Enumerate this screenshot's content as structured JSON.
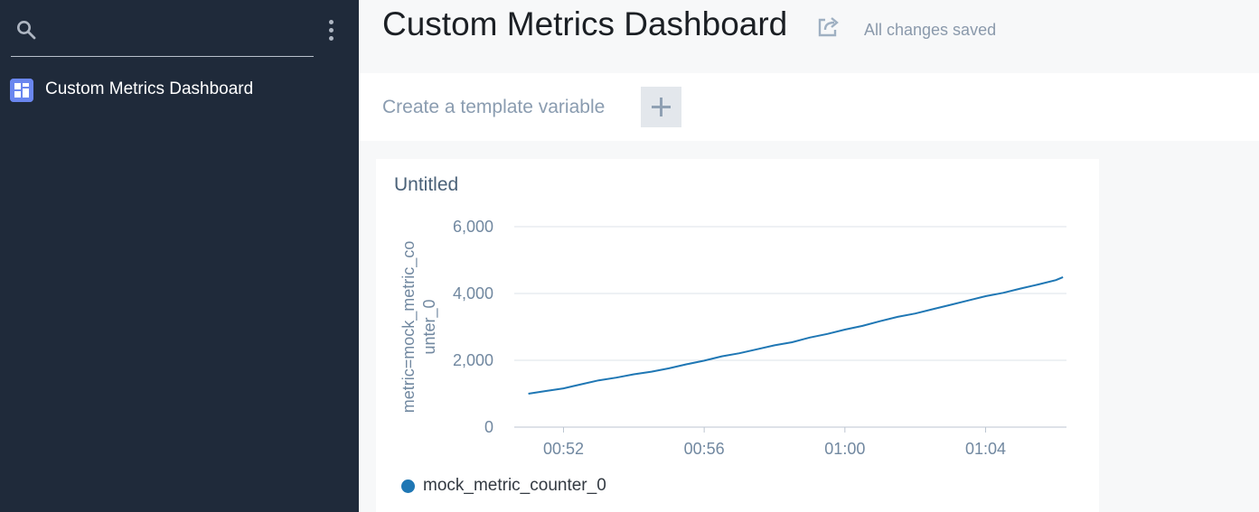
{
  "sidebar": {
    "search_placeholder": "",
    "nav_items": [
      {
        "label": "Custom Metrics Dashboard",
        "icon": "dashboard-icon",
        "color": "#6a86ef"
      }
    ]
  },
  "header": {
    "title": "Custom Metrics Dashboard",
    "save_status": "All changes saved"
  },
  "template_bar": {
    "label": "Create a template variable"
  },
  "panel": {
    "title": "Untitled"
  },
  "chart_data": {
    "type": "line",
    "title": "Untitled",
    "xlabel": "",
    "ylabel_lines": [
      "metric=mock_metric_co",
      "unter_0"
    ],
    "x_ticks": [
      "00:52",
      "00:56",
      "01:00",
      "01:04"
    ],
    "x_tick_minutes": [
      52,
      56,
      60,
      64
    ],
    "y_ticks": [
      "0",
      "2,000",
      "4,000",
      "6,000"
    ],
    "y_tick_values": [
      0,
      2000,
      4000,
      6000
    ],
    "xlim_minutes": [
      50.6,
      66.3
    ],
    "ylim": [
      0,
      6000
    ],
    "grid": true,
    "series": [
      {
        "name": "mock_metric_counter_0",
        "color": "#1f77b4",
        "x_minutes": [
          51.0,
          51.5,
          52.0,
          52.5,
          53.0,
          53.5,
          54.0,
          54.5,
          55.0,
          55.5,
          56.0,
          56.5,
          57.0,
          57.5,
          58.0,
          58.5,
          59.0,
          59.5,
          60.0,
          60.5,
          61.0,
          61.5,
          62.0,
          62.5,
          63.0,
          63.5,
          64.0,
          64.5,
          65.0,
          65.5,
          66.0,
          66.2
        ],
        "values": [
          1000,
          1080,
          1160,
          1280,
          1400,
          1480,
          1580,
          1660,
          1760,
          1880,
          1990,
          2120,
          2210,
          2330,
          2450,
          2540,
          2680,
          2790,
          2920,
          3030,
          3170,
          3300,
          3400,
          3530,
          3660,
          3790,
          3920,
          4020,
          4150,
          4270,
          4400,
          4490
        ]
      }
    ],
    "legend_placement": "bottom-left"
  }
}
